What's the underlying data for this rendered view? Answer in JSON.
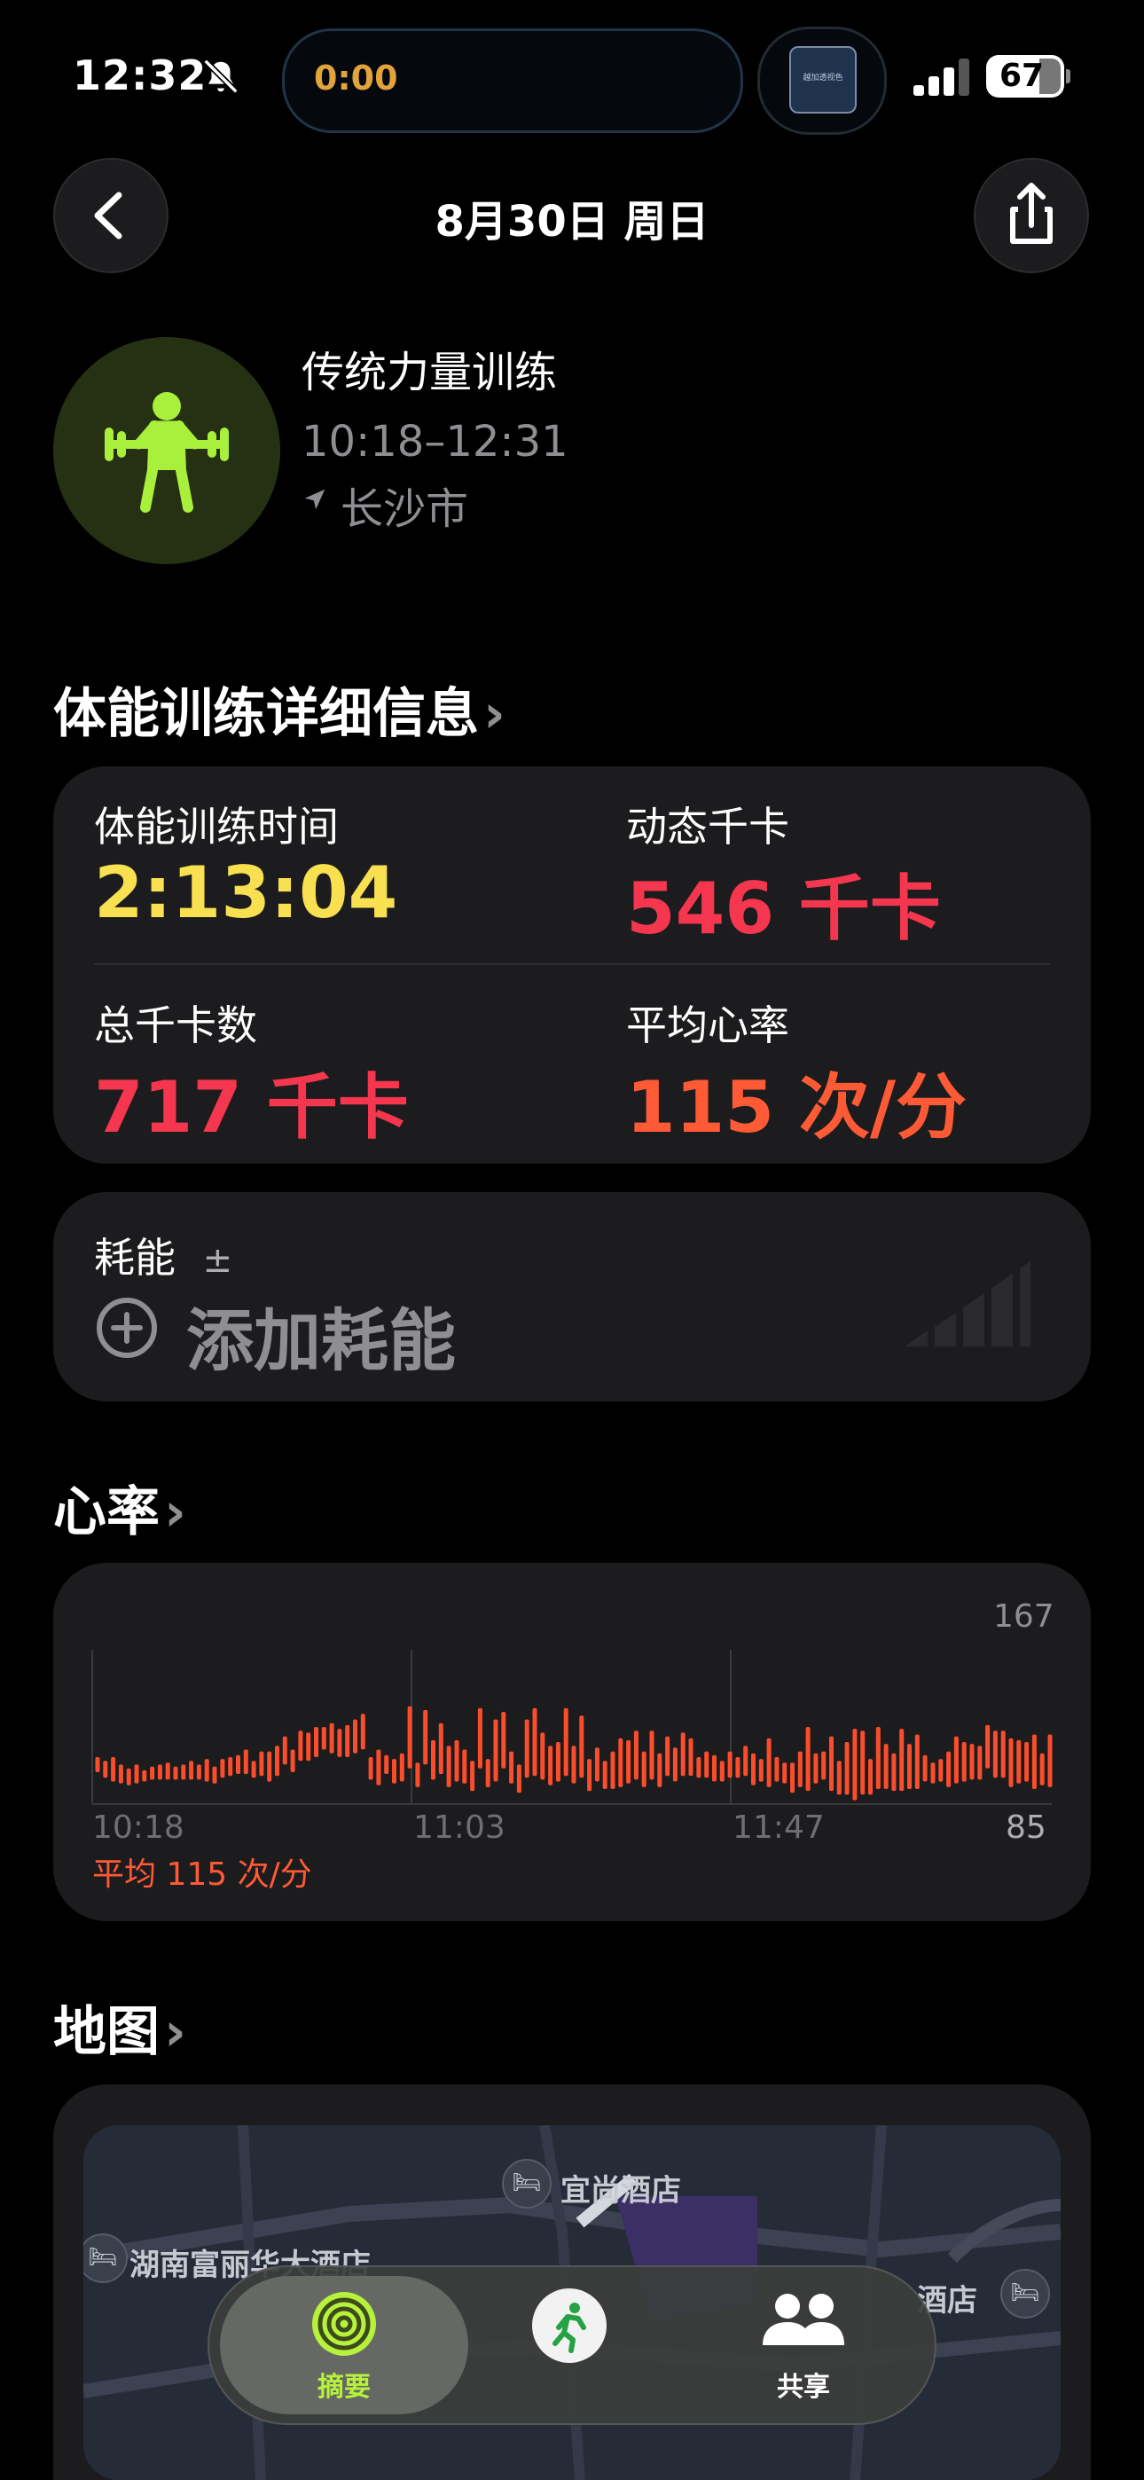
{
  "status_bar": {
    "time": "12:32",
    "island_timer": "0:00",
    "battery": "67",
    "art_text": "越加透视色"
  },
  "header": {
    "date_title": "8月30日 周日"
  },
  "workout": {
    "name": "传统力量训练",
    "time_range": "10:18–12:31",
    "location": "长沙市"
  },
  "details": {
    "section_title": "体能训练详细信息",
    "duration_label": "体能训练时间",
    "duration_value": "2:13:04",
    "active_cal_label": "动态千卡",
    "active_cal_value": "546 千卡",
    "total_cal_label": "总千卡数",
    "total_cal_value": "717 千卡",
    "avg_hr_label": "平均心率",
    "avg_hr_value": "115 次/分"
  },
  "effort": {
    "label": "耗能",
    "plusminus": "±",
    "add_label": "添加耗能"
  },
  "heart_rate": {
    "section_title": "心率",
    "max_label": "167",
    "min_label": "85",
    "x_labels": [
      "10:18",
      "11:03",
      "11:47"
    ],
    "avg_text": "平均 115 次/分"
  },
  "chart_data": {
    "type": "bar",
    "title": "",
    "xlabel": "",
    "ylabel": "",
    "ylim": [
      85,
      167
    ],
    "x_ticks": [
      "10:18",
      "11:03",
      "11:47"
    ],
    "series": [
      {
        "values": [
          [
            110,
            102
          ],
          [
            108,
            99
          ],
          [
            110,
            97
          ],
          [
            106,
            96
          ],
          [
            104,
            95
          ],
          [
            106,
            96
          ],
          [
            103,
            97
          ],
          [
            105,
            98
          ],
          [
            106,
            98
          ],
          [
            107,
            98
          ],
          [
            105,
            98
          ],
          [
            106,
            98
          ],
          [
            108,
            98
          ],
          [
            106,
            98
          ],
          [
            109,
            97
          ],
          [
            105,
            96
          ],
          [
            109,
            99
          ],
          [
            110,
            100
          ],
          [
            111,
            101
          ],
          [
            114,
            101
          ],
          [
            108,
            99
          ],
          [
            113,
            100
          ],
          [
            113,
            97
          ],
          [
            116,
            100
          ],
          [
            121,
            106
          ],
          [
            114,
            102
          ],
          [
            124,
            108
          ],
          [
            123,
            108
          ],
          [
            126,
            110
          ],
          [
            126,
            114
          ],
          [
            128,
            112
          ],
          [
            125,
            110
          ],
          [
            127,
            110
          ],
          [
            130,
            112
          ],
          [
            133,
            114
          ],
          [
            110,
            98
          ],
          [
            114,
            95
          ],
          [
            111,
            101
          ],
          [
            109,
            96
          ],
          [
            112,
            97
          ],
          [
            137,
            104
          ],
          [
            107,
            94
          ],
          [
            135,
            106
          ],
          [
            119,
            98
          ],
          [
            128,
            101
          ],
          [
            116,
            94
          ],
          [
            119,
            97
          ],
          [
            114,
            96
          ],
          [
            108,
            92
          ],
          [
            136,
            104
          ],
          [
            109,
            94
          ],
          [
            130,
            97
          ],
          [
            134,
            104
          ],
          [
            113,
            96
          ],
          [
            106,
            91
          ],
          [
            130,
            99
          ],
          [
            136,
            100
          ],
          [
            123,
            98
          ],
          [
            116,
            95
          ],
          [
            118,
            97
          ],
          [
            136,
            100
          ],
          [
            116,
            96
          ],
          [
            132,
            99
          ],
          [
            109,
            92
          ],
          [
            115,
            97
          ],
          [
            108,
            93
          ],
          [
            113,
            93
          ],
          [
            120,
            94
          ],
          [
            119,
            96
          ],
          [
            124,
            98
          ],
          [
            113,
            94
          ],
          [
            124,
            98
          ],
          [
            112,
            94
          ],
          [
            121,
            100
          ],
          [
            115,
            97
          ],
          [
            123,
            100
          ],
          [
            120,
            100
          ],
          [
            110,
            99
          ],
          [
            113,
            99
          ],
          [
            111,
            97
          ],
          [
            108,
            97
          ],
          [
            113,
            99
          ],
          [
            110,
            99
          ],
          [
            116,
            100
          ],
          [
            112,
            95
          ],
          [
            109,
            97
          ],
          [
            120,
            94
          ],
          [
            110,
            97
          ],
          [
            107,
            96
          ],
          [
            107,
            91
          ],
          [
            113,
            94
          ],
          [
            126,
            92
          ],
          [
            112,
            96
          ],
          [
            113,
            98
          ],
          [
            121,
            92
          ],
          [
            108,
            90
          ],
          [
            118,
            90
          ],
          [
            125,
            87
          ],
          [
            124,
            90
          ],
          [
            109,
            90
          ],
          [
            126,
            93
          ],
          [
            117,
            93
          ],
          [
            112,
            92
          ],
          [
            125,
            92
          ],
          [
            117,
            93
          ],
          [
            122,
            93
          ],
          [
            111,
            97
          ],
          [
            107,
            96
          ],
          [
            109,
            97
          ],
          [
            113,
            94
          ],
          [
            121,
            96
          ],
          [
            118,
            97
          ],
          [
            117,
            98
          ],
          [
            116,
            98
          ],
          [
            127,
            104
          ],
          [
            124,
            99
          ],
          [
            124,
            99
          ],
          [
            120,
            94
          ],
          [
            119,
            96
          ],
          [
            118,
            97
          ],
          [
            122,
            93
          ],
          [
            112,
            95
          ],
          [
            122,
            94
          ]
        ]
      }
    ]
  },
  "map": {
    "section_title": "地图",
    "labels": [
      "宜尚酒店",
      "湖南富丽华大酒店",
      "酒店"
    ]
  },
  "tabbar": {
    "summary": "摘要",
    "fitness_icon": "runner-icon",
    "sharing": "共享"
  }
}
